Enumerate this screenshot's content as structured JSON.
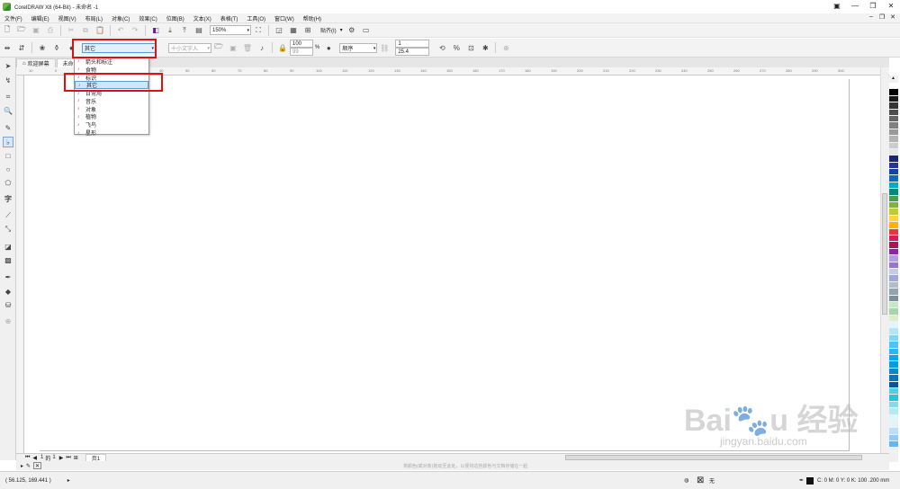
{
  "window": {
    "title": "CorelDRAW X8 (64-Bit) - 未命名 -1",
    "controls": [
      "▣",
      "—",
      "❐",
      "✕"
    ]
  },
  "menu": [
    "文件(F)",
    "编辑(E)",
    "视图(V)",
    "布局(L)",
    "对象(C)",
    "效果(C)",
    "位图(B)",
    "文本(X)",
    "表格(T)",
    "工具(O)",
    "窗口(W)",
    "帮助(H)"
  ],
  "toolbar1": {
    "zoom": "150%",
    "snap_label": "贴齐(I)"
  },
  "toolbar2": {
    "category_selected": "其它",
    "glyph_placeholder": "十小文字入",
    "size_value": "100",
    "size_value2": "99",
    "percent": "%",
    "order_label": "顺序",
    "num_a": "1",
    "num_b": "25.4"
  },
  "tabs": [
    "欢迎屏幕",
    "未命名"
  ],
  "ruler": {
    "h_ticks": [
      "10",
      "0",
      "10",
      "20",
      "30",
      "40",
      "50",
      "60",
      "70",
      "80",
      "90",
      "100",
      "110",
      "120",
      "130",
      "140",
      "150",
      "160",
      "170",
      "180",
      "190",
      "200",
      "210",
      "220",
      "230",
      "240",
      "250",
      "260",
      "270",
      "280",
      "290",
      "300"
    ]
  },
  "dropdown": {
    "items": [
      {
        "label": "箭头和标注",
        "selected": false
      },
      {
        "label": "食物",
        "selected": false
      },
      {
        "label": "标识",
        "selected": false
      },
      {
        "label": "其它",
        "selected": true
      },
      {
        "label": "日常用",
        "selected": false
      },
      {
        "label": "音乐",
        "selected": false
      },
      {
        "label": "对象",
        "selected": false
      },
      {
        "label": "植物",
        "selected": false
      },
      {
        "label": "飞鸟",
        "selected": false
      },
      {
        "label": "星形",
        "selected": false
      }
    ]
  },
  "page_nav": {
    "current": "1",
    "of_label": "的",
    "total": "1",
    "page_tab": "页1"
  },
  "status": {
    "coords": "( 56.125, 169.441 )",
    "hint": "将颜色(或对象)拖动至此处，以便将这些颜色与文档存储在一起",
    "fill_label": "无",
    "color_info": "C: 0 M: 0 Y: 0 K: 100  .200 mm"
  },
  "palette": [
    "#ffffff",
    "#000000",
    "#1a1a1a",
    "#333333",
    "#4d4d4d",
    "#666666",
    "#808080",
    "#999999",
    "#b3b3b3",
    "#cccccc",
    "#e6e6e6",
    "#1a237e",
    "#283593",
    "#0d47a1",
    "#1565c0",
    "#00acc1",
    "#00897b",
    "#43a047",
    "#7cb342",
    "#c0ca33",
    "#fdd835",
    "#ffb300",
    "#e53935",
    "#d81b60",
    "#ad1457",
    "#8e24aa",
    "#b39ddb",
    "#9575cd",
    "#c5cae9",
    "#9fa8da",
    "#b0bec5",
    "#90a4ae",
    "#78909c",
    "#c8e6c9",
    "#a5d6a7",
    "#dcedc8",
    "#e1f5fe",
    "#b3e5fc",
    "#81d4fa",
    "#4fc3f7",
    "#29b6f6",
    "#03a9f4",
    "#039be5",
    "#0288d1",
    "#0277bd",
    "#01579b",
    "#4dd0e1",
    "#26c6da",
    "#80deea",
    "#b2ebf2",
    "#e0f7fa",
    "#e3f2fd",
    "#bbdefb",
    "#90caf9",
    "#64b5f6"
  ]
}
